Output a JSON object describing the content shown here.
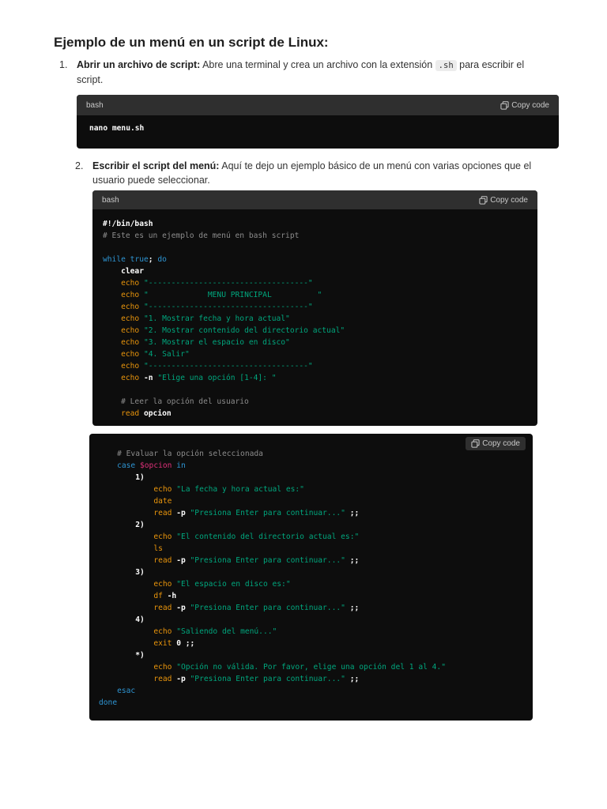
{
  "heading": "Ejemplo de un menú en un script de Linux:",
  "step1": {
    "number": "1.",
    "bold": "Abrir un archivo de script:",
    "text_before": " Abre una terminal y crea un archivo con la extensión ",
    "code": ".sh",
    "text_after": " para escribir el script."
  },
  "step2": {
    "number": "2.",
    "bold": "Escribir el script del menú:",
    "text": " Aquí te dejo un ejemplo básico de un menú con varias opciones que el usuario puede seleccionar."
  },
  "code_block_1": {
    "language": "bash",
    "copy_label": "Copy code",
    "code": "nano menu.sh"
  },
  "code_block_2": {
    "language": "bash",
    "copy_label": "Copy code",
    "lines": {
      "shebang": "#!/bin/bash",
      "comment1": "# Este es un ejemplo de menú en bash script",
      "while_kw": "while",
      "true_val": " true",
      "semi": ";",
      "do_kw": " do",
      "clear": "clear",
      "echo": "echo",
      "sep": "\"-----------------------------------\"",
      "menu_title": "\"             MENU PRINCIPAL          \"",
      "opt1": "\"1. Mostrar fecha y hora actual\"",
      "opt2": "\"2. Mostrar contenido del directorio actual\"",
      "opt3": "\"3. Mostrar el espacio en disco\"",
      "opt4": "\"4. Salir\"",
      "n_flag": " -n",
      "prompt": "\"Elige una opción [1-4]: \"",
      "comment2": "# Leer la opción del usuario",
      "read_kw": "read",
      "opcion": " opcion"
    }
  },
  "code_block_3": {
    "copy_label": "Copy code",
    "lines": {
      "comment3": "# Evaluar la opción seleccionada",
      "case_kw": "case",
      "var": " $opcion",
      "in_kw": " in",
      "c1": "1)",
      "c2": "2)",
      "c3": "3)",
      "c4": "4)",
      "cstar": "*)",
      "echo": "echo",
      "msg1": "\"La fecha y hora actual es:\"",
      "date": "date",
      "read": "read",
      "p_flag": " -p",
      "press": "\"Presiona Enter para continuar...\"",
      "dsemi": " ;;",
      "msg2": "\"El contenido del directorio actual es:\"",
      "ls": "ls",
      "msg3": "\"El espacio en disco es:\"",
      "df": "df",
      "h_flag": " -h",
      "msg4": "\"Saliendo del menú...\"",
      "exit": "exit",
      "zero": " 0",
      "msg5": "\"Opción no válida. Por favor, elige una opción del 1 al 4.\"",
      "esac": "esac",
      "done": "done"
    }
  }
}
